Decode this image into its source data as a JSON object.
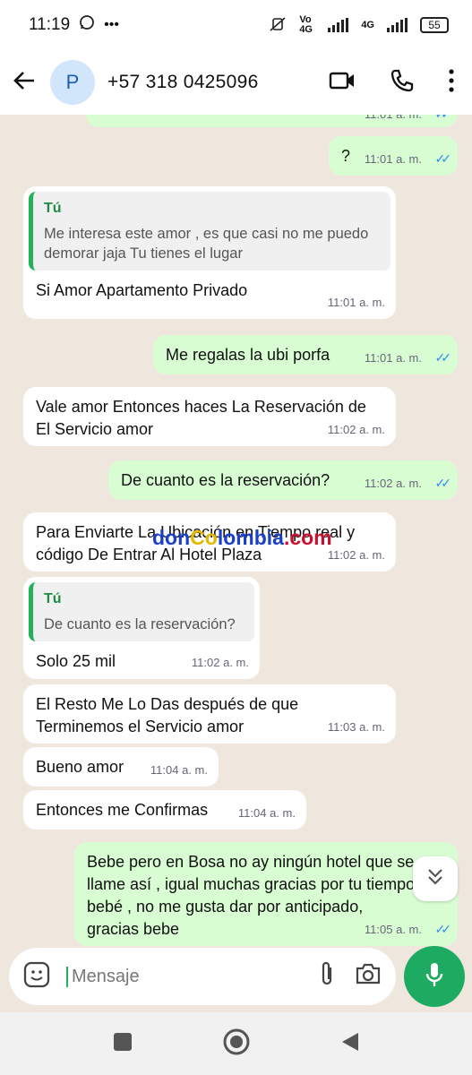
{
  "status": {
    "time": "11:19",
    "network": "Vo 4G",
    "network2": "4G",
    "battery": "55"
  },
  "header": {
    "avatar_letter": "P",
    "contact": "+57 318 0425096"
  },
  "watermark": {
    "part1": "don",
    "part2": "Co",
    "part3": "lombia",
    "part4": ".com"
  },
  "messages": [
    {
      "text": "?",
      "time": "11:01 a. m."
    },
    {
      "quote_author": "Tú",
      "quote_text": "Me interesa este amor , es que casi no me puedo demorar jaja Tu tienes el lugar",
      "text": "Si Amor Apartamento Privado",
      "time": "11:01 a. m."
    },
    {
      "text": "Me regalas la ubi porfa",
      "time": "11:01 a. m."
    },
    {
      "text": "Vale amor Entonces haces La Reservación de El Servicio amor",
      "time": "11:02 a. m."
    },
    {
      "text": "De cuanto es la reservación?",
      "time": "11:02 a. m."
    },
    {
      "text": "Para Enviarte La Ubicación en Tiempo real y código De Entrar Al Hotel Plaza",
      "time": "11:02 a. m."
    },
    {
      "quote_author": "Tú",
      "quote_text": "De cuanto es la reservación?",
      "text": "Solo 25 mil",
      "time": "11:02 a. m."
    },
    {
      "text": "El Resto Me Lo Das después de que Terminemos el Servicio amor",
      "time": "11:03 a. m."
    },
    {
      "text": "Bueno amor",
      "time": "11:04 a. m."
    },
    {
      "text": "Entonces me Confirmas",
      "time": "11:04 a. m."
    },
    {
      "text": "Bebe pero en Bosa no ay ningún hotel que se llame así , igual muchas gracias por tu tiempo bebé , no me gusta dar por anticipado, gracias bebe",
      "time": "11:05 a. m."
    }
  ],
  "composer": {
    "placeholder": "Mensaje"
  },
  "colors": {
    "accent": "#1daa61",
    "outgoing": "#d9fdd3",
    "tick": "#2f8fe8"
  }
}
